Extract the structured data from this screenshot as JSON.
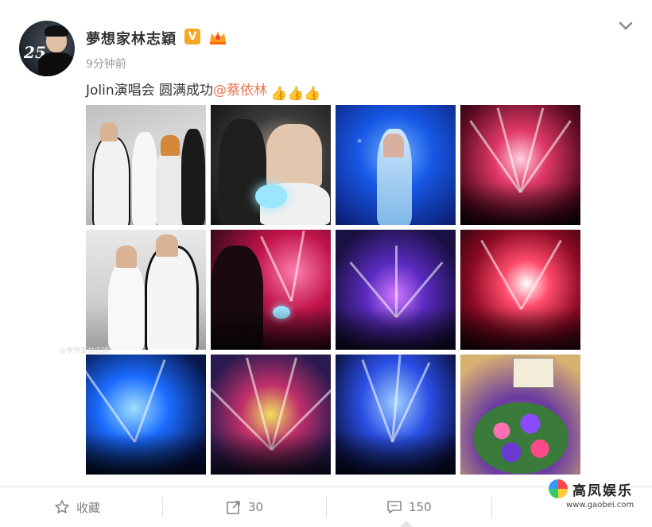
{
  "post": {
    "username": "夢想家林志穎",
    "avatar_badge": "25",
    "verified_badge": "V",
    "time": "9分钟前",
    "text_main": "Jolin演唱会 圆满成功",
    "mention": "@蔡依林",
    "emoji": "👍👍👍",
    "photo_watermark": "@夢想家林志穎",
    "photos": [
      {
        "id": "photo-1"
      },
      {
        "id": "photo-2"
      },
      {
        "id": "photo-3"
      },
      {
        "id": "photo-4"
      },
      {
        "id": "photo-5"
      },
      {
        "id": "photo-6"
      },
      {
        "id": "photo-7"
      },
      {
        "id": "photo-8"
      },
      {
        "id": "photo-9"
      },
      {
        "id": "photo-10"
      },
      {
        "id": "photo-11"
      },
      {
        "id": "photo-12"
      }
    ]
  },
  "actions": {
    "favorite_label": "收藏",
    "repost_count": "30",
    "comment_count": "150"
  },
  "brand": {
    "logo_text": "高凤娱乐",
    "logo_url": "www.gaobei.com",
    "accent_color": "#eb7350",
    "badge_color": "#f5a623"
  }
}
